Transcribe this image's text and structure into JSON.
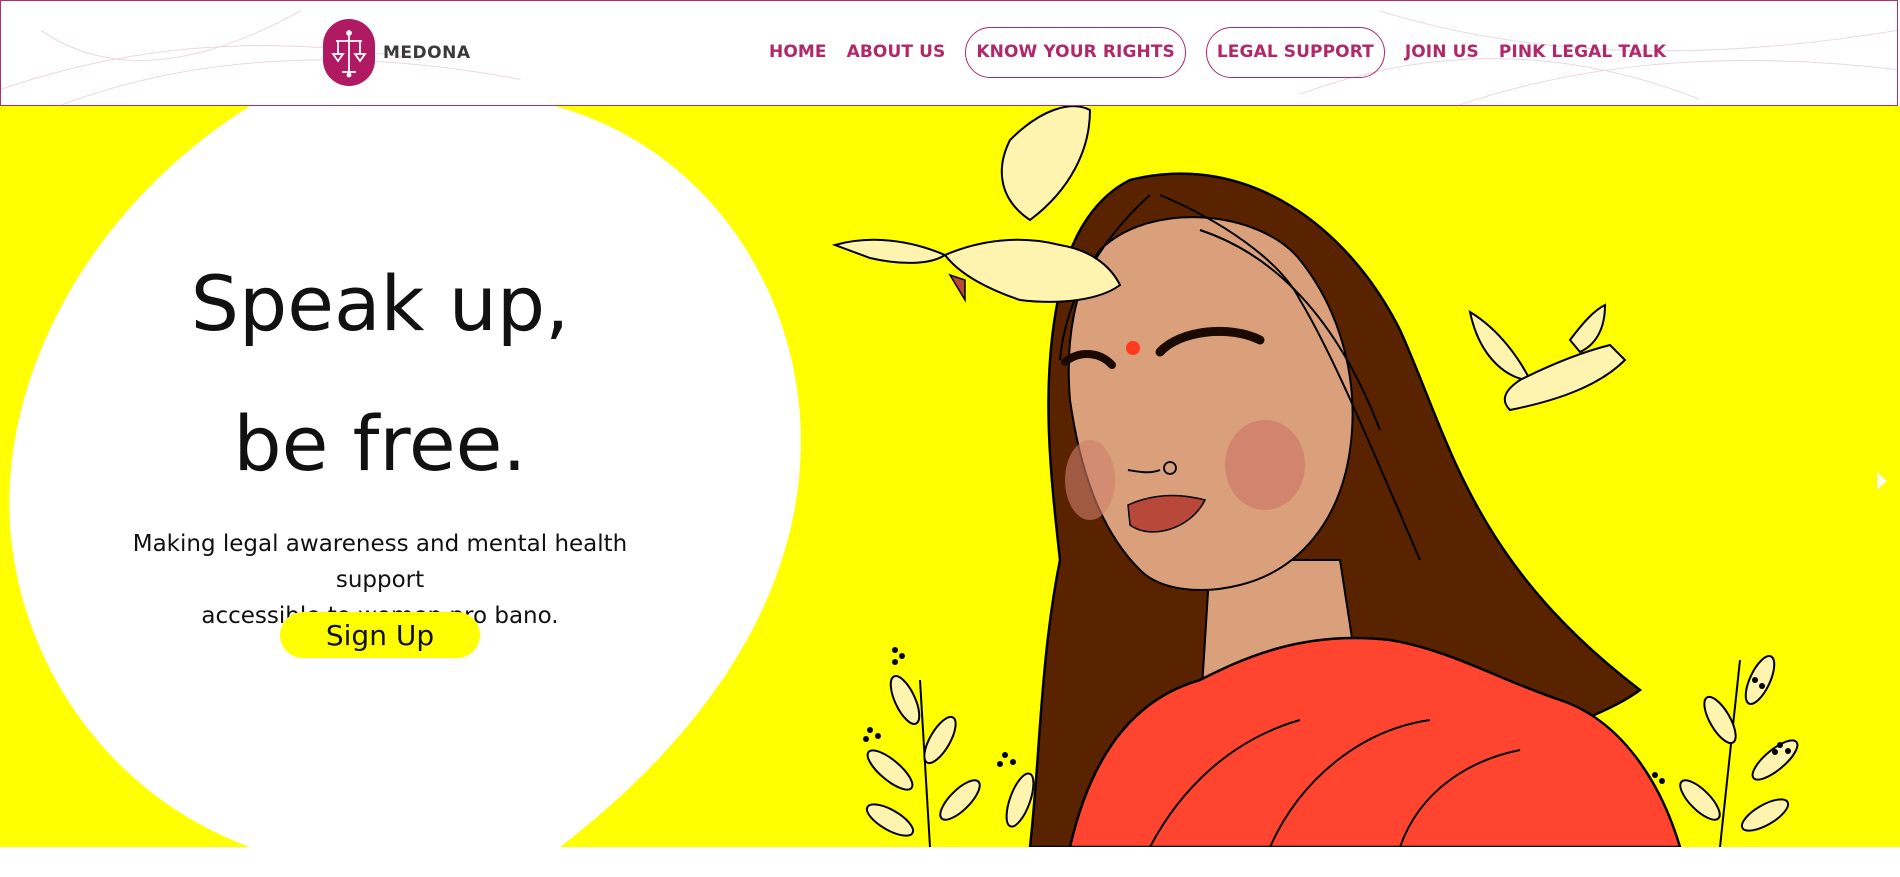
{
  "brand": {
    "name": "MEDONA",
    "color": "#b01a62"
  },
  "nav": {
    "items": [
      {
        "label": "HOME",
        "style": "plain"
      },
      {
        "label": "ABOUT US",
        "style": "plain"
      },
      {
        "label": "KNOW YOUR RIGHTS",
        "style": "pill"
      },
      {
        "label": "LEGAL SUPPORT",
        "style": "pill"
      },
      {
        "label": "JOIN US",
        "style": "plain"
      },
      {
        "label": "PINK LEGAL TALK",
        "style": "plain"
      }
    ],
    "color": "#b0286a"
  },
  "hero": {
    "title_line1": "Speak up,",
    "title_line2": "be free.",
    "subtitle_line1": "Making legal awareness and mental health support",
    "subtitle_line2": "accessible to women pro bano.",
    "cta_label": "Sign Up",
    "background": "#ffff00"
  },
  "icons": {
    "logo": "scales-of-justice-icon",
    "carousel_next": "chevron-right-icon"
  }
}
